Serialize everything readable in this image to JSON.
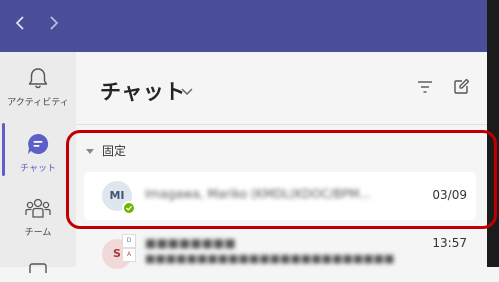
{
  "titlebar": {
    "back_icon": "chevron-left",
    "forward_icon": "chevron-right"
  },
  "rail": {
    "items": [
      {
        "label": "アクティビティ",
        "icon": "bell-icon"
      },
      {
        "label": "チャット",
        "icon": "chat-icon",
        "active": true
      },
      {
        "label": "チーム",
        "icon": "teams-icon"
      }
    ]
  },
  "chat_panel": {
    "title": "チャット",
    "title_icon": "chevron-down-icon",
    "actions": [
      "filter-icon",
      "new-chat-icon"
    ],
    "section_label": "固定",
    "pinned": [
      {
        "initials": "MI",
        "name": "Imagawa, Mariko (KMDL(KDOC/BPM...",
        "time": "03/09",
        "presence": "available"
      }
    ],
    "recent": [
      {
        "initials": "S",
        "name": "■■■■■■■■",
        "preview": "■■■■■■■■■■■■■■■■■■■■■■■■",
        "time": "13:57"
      }
    ]
  },
  "colors": {
    "titlebar": "#4b4f99",
    "accent": "#5b5fc7",
    "highlight": "#c00000",
    "presence": "#6bb700"
  }
}
